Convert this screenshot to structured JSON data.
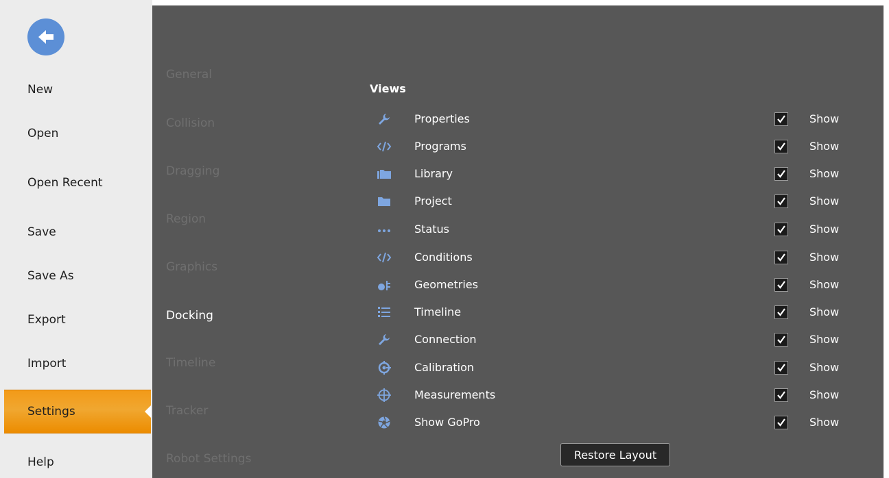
{
  "menu": {
    "items": [
      {
        "label": "New"
      },
      {
        "label": "Open"
      },
      {
        "label": "Open Recent"
      },
      {
        "label": "Save"
      },
      {
        "label": "Save As"
      },
      {
        "label": "Export"
      },
      {
        "label": "Import"
      },
      {
        "label": "Settings",
        "active": true
      },
      {
        "label": "Help"
      }
    ],
    "back_icon": "arrow-left-circle-icon",
    "accent_color": "#f39a18"
  },
  "categories": {
    "items": [
      {
        "label": "General"
      },
      {
        "label": "Collision"
      },
      {
        "label": "Dragging"
      },
      {
        "label": "Region"
      },
      {
        "label": "Graphics"
      },
      {
        "label": "Docking",
        "active": true
      },
      {
        "label": "Timeline"
      },
      {
        "label": "Tracker"
      },
      {
        "label": "Robot Settings"
      }
    ]
  },
  "views": {
    "title": "Views",
    "items": [
      {
        "label": "Properties",
        "icon": "wrench-icon",
        "checked": true,
        "show": "Show"
      },
      {
        "label": "Programs",
        "icon": "code-icon",
        "checked": true,
        "show": "Show"
      },
      {
        "label": "Library",
        "icon": "folders-icon",
        "checked": true,
        "show": "Show"
      },
      {
        "label": "Project",
        "icon": "folder-icon",
        "checked": true,
        "show": "Show"
      },
      {
        "label": "Status",
        "icon": "dots-icon",
        "checked": true,
        "show": "Show"
      },
      {
        "label": "Conditions",
        "icon": "code-icon",
        "checked": true,
        "show": "Show"
      },
      {
        "label": "Geometries",
        "icon": "shapes-icon",
        "checked": true,
        "show": "Show"
      },
      {
        "label": "Timeline",
        "icon": "list-icon",
        "checked": true,
        "show": "Show"
      },
      {
        "label": "Connection",
        "icon": "wrench-icon",
        "checked": true,
        "show": "Show"
      },
      {
        "label": "Calibration",
        "icon": "target-icon",
        "checked": true,
        "show": "Show"
      },
      {
        "label": "Measurements",
        "icon": "crosshair-icon",
        "checked": true,
        "show": "Show"
      },
      {
        "label": "Show GoPro",
        "icon": "aperture-icon",
        "checked": true,
        "show": "Show"
      }
    ]
  },
  "restore_button": "Restore Layout",
  "colors": {
    "panel_bg": "#575757",
    "menu_bg": "#ececec",
    "icon_blue": "#7ea6e0",
    "back_button": "#5c8fd6"
  }
}
